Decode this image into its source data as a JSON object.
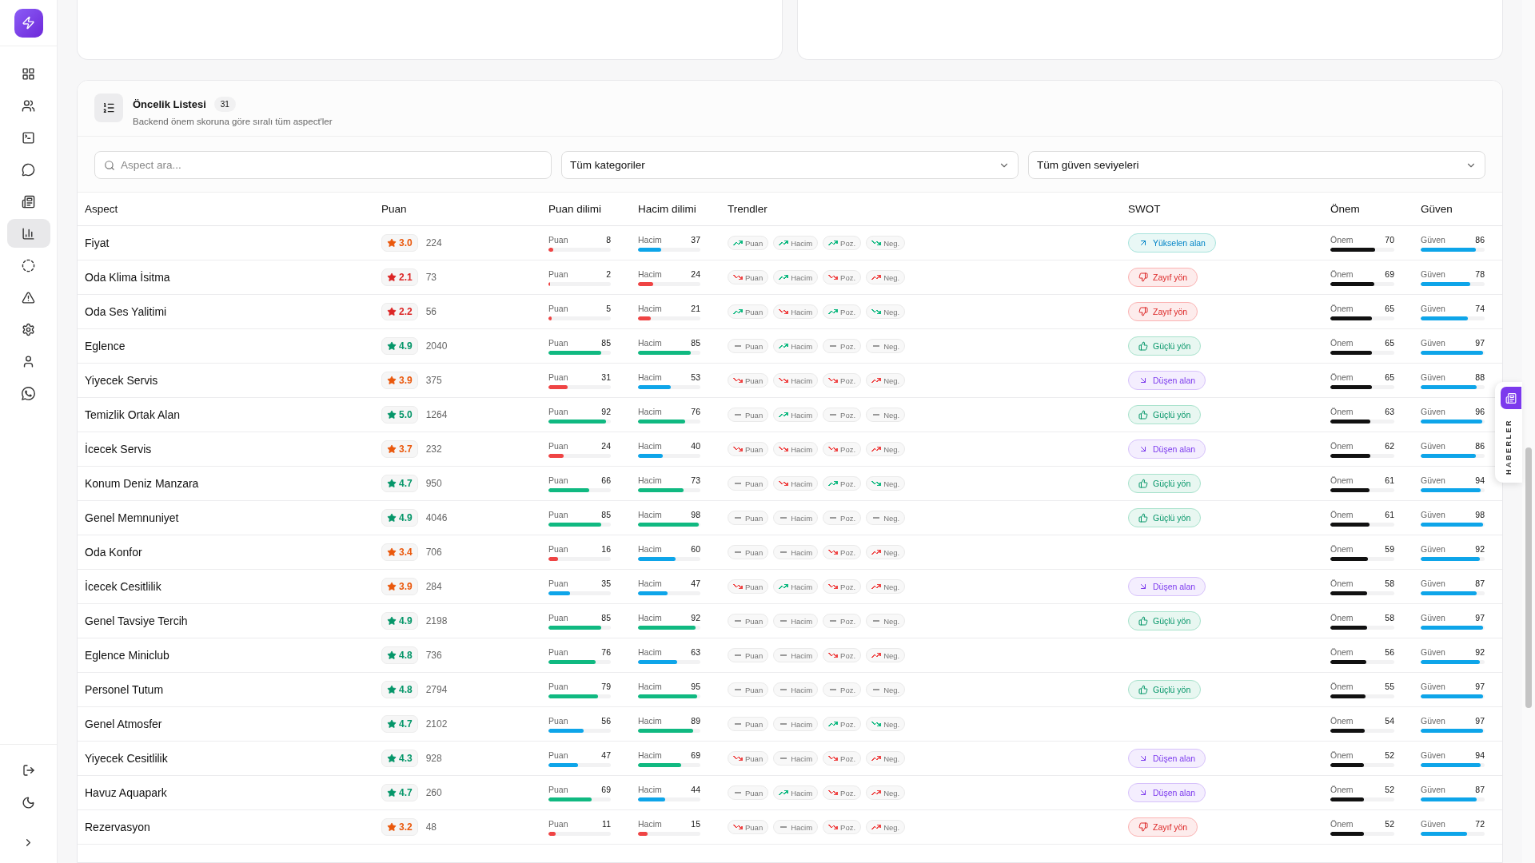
{
  "sidebar": {
    "items": [
      {
        "selected": false
      },
      {
        "selected": false
      },
      {
        "selected": false
      },
      {
        "selected": false
      },
      {
        "selected": false
      },
      {
        "selected": true
      },
      {
        "selected": false
      },
      {
        "selected": false
      },
      {
        "selected": false
      },
      {
        "selected": false
      },
      {
        "selected": false
      }
    ]
  },
  "priority_list": {
    "title": "Öncelik Listesi",
    "count": "31",
    "subtitle": "Backend önem skoruna göre sıralı tüm aspect'ler",
    "search": {
      "placeholder": "Aspect ara..."
    },
    "filters": [
      {
        "value": "Tüm kategoriler"
      },
      {
        "value": "Tüm güven seviyeleri"
      }
    ],
    "columns": [
      "Aspect",
      "Puan",
      "Puan dilimi",
      "Hacim dilimi",
      "Trendler",
      "SWOT",
      "Önem",
      "Güven"
    ],
    "rows": [
      {
        "aspect": "Fiyat",
        "rating": {
          "value": "3.0",
          "color": "#ea580c"
        },
        "reviews": "224",
        "score": {
          "label": "Puan",
          "value": "8",
          "level": 0.08
        },
        "volume": {
          "label": "Hacim",
          "value": "37",
          "level": 0.37
        },
        "trends": [
          {
            "label": "Puan",
            "kind": "up",
            "color": "#10b981"
          },
          {
            "label": "Hacim",
            "kind": "up",
            "color": "#10b981"
          },
          {
            "label": "Poz.",
            "kind": "up",
            "color": "#10b981"
          },
          {
            "label": "Neg.",
            "kind": "down",
            "color": "#10b981"
          }
        ],
        "swot": {
          "kind": "rising",
          "label": "Yükselen alan"
        },
        "importance": {
          "label": "Önem",
          "value": "70",
          "level": 0.7
        },
        "confidence": {
          "label": "Güven",
          "value": "86",
          "level": 0.86
        }
      },
      {
        "aspect": "Oda Klima İsitma",
        "rating": {
          "value": "2.1",
          "color": "#dc2626"
        },
        "reviews": "73",
        "score": {
          "label": "Puan",
          "value": "2",
          "level": 0.02
        },
        "volume": {
          "label": "Hacim",
          "value": "24",
          "level": 0.24
        },
        "trends": [
          {
            "label": "Puan",
            "kind": "down",
            "color": "#ef4444"
          },
          {
            "label": "Hacim",
            "kind": "up",
            "color": "#10b981"
          },
          {
            "label": "Poz.",
            "kind": "down",
            "color": "#ef4444"
          },
          {
            "label": "Neg.",
            "kind": "up",
            "color": "#ef4444"
          }
        ],
        "swot": {
          "kind": "weak",
          "label": "Zayıf yön"
        },
        "importance": {
          "label": "Önem",
          "value": "69",
          "level": 0.69
        },
        "confidence": {
          "label": "Güven",
          "value": "78",
          "level": 0.78
        }
      },
      {
        "aspect": "Oda Ses Yalitimi",
        "rating": {
          "value": "2.2",
          "color": "#dc2626"
        },
        "reviews": "56",
        "score": {
          "label": "Puan",
          "value": "5",
          "level": 0.05
        },
        "volume": {
          "label": "Hacim",
          "value": "21",
          "level": 0.21
        },
        "trends": [
          {
            "label": "Puan",
            "kind": "up",
            "color": "#10b981"
          },
          {
            "label": "Hacim",
            "kind": "down",
            "color": "#ef4444"
          },
          {
            "label": "Poz.",
            "kind": "up",
            "color": "#10b981"
          },
          {
            "label": "Neg.",
            "kind": "down",
            "color": "#10b981"
          }
        ],
        "swot": {
          "kind": "weak",
          "label": "Zayıf yön"
        },
        "importance": {
          "label": "Önem",
          "value": "65",
          "level": 0.65
        },
        "confidence": {
          "label": "Güven",
          "value": "74",
          "level": 0.74
        }
      },
      {
        "aspect": "Eglence",
        "rating": {
          "value": "4.9",
          "color": "#059669"
        },
        "reviews": "2040",
        "score": {
          "label": "Puan",
          "value": "85",
          "level": 0.85
        },
        "volume": {
          "label": "Hacim",
          "value": "85",
          "level": 0.85
        },
        "trends": [
          {
            "label": "Puan",
            "kind": "flat",
            "color": "#999999"
          },
          {
            "label": "Hacim",
            "kind": "up",
            "color": "#10b981"
          },
          {
            "label": "Poz.",
            "kind": "flat",
            "color": "#999999"
          },
          {
            "label": "Neg.",
            "kind": "flat",
            "color": "#999999"
          }
        ],
        "swot": {
          "kind": "strong",
          "label": "Güçlü yön"
        },
        "importance": {
          "label": "Önem",
          "value": "65",
          "level": 0.65
        },
        "confidence": {
          "label": "Güven",
          "value": "97",
          "level": 0.97
        }
      },
      {
        "aspect": "Yiyecek Servis",
        "rating": {
          "value": "3.9",
          "color": "#ea580c"
        },
        "reviews": "375",
        "score": {
          "label": "Puan",
          "value": "31",
          "level": 0.31
        },
        "volume": {
          "label": "Hacim",
          "value": "53",
          "level": 0.53
        },
        "trends": [
          {
            "label": "Puan",
            "kind": "down",
            "color": "#ef4444"
          },
          {
            "label": "Hacim",
            "kind": "down",
            "color": "#ef4444"
          },
          {
            "label": "Poz.",
            "kind": "down",
            "color": "#ef4444"
          },
          {
            "label": "Neg.",
            "kind": "up",
            "color": "#ef4444"
          }
        ],
        "swot": {
          "kind": "falling",
          "label": "Düşen alan"
        },
        "importance": {
          "label": "Önem",
          "value": "65",
          "level": 0.65
        },
        "confidence": {
          "label": "Güven",
          "value": "88",
          "level": 0.88
        }
      },
      {
        "aspect": "Temizlik Ortak Alan",
        "rating": {
          "value": "5.0",
          "color": "#059669"
        },
        "reviews": "1264",
        "score": {
          "label": "Puan",
          "value": "92",
          "level": 0.92
        },
        "volume": {
          "label": "Hacim",
          "value": "76",
          "level": 0.76
        },
        "trends": [
          {
            "label": "Puan",
            "kind": "flat",
            "color": "#999999"
          },
          {
            "label": "Hacim",
            "kind": "up",
            "color": "#10b981"
          },
          {
            "label": "Poz.",
            "kind": "flat",
            "color": "#999999"
          },
          {
            "label": "Neg.",
            "kind": "flat",
            "color": "#999999"
          }
        ],
        "swot": {
          "kind": "strong",
          "label": "Güçlü yön"
        },
        "importance": {
          "label": "Önem",
          "value": "63",
          "level": 0.63
        },
        "confidence": {
          "label": "Güven",
          "value": "96",
          "level": 0.96
        }
      },
      {
        "aspect": "İcecek Servis",
        "rating": {
          "value": "3.7",
          "color": "#ea580c"
        },
        "reviews": "232",
        "score": {
          "label": "Puan",
          "value": "24",
          "level": 0.24
        },
        "volume": {
          "label": "Hacim",
          "value": "40",
          "level": 0.4
        },
        "trends": [
          {
            "label": "Puan",
            "kind": "down",
            "color": "#ef4444"
          },
          {
            "label": "Hacim",
            "kind": "down",
            "color": "#ef4444"
          },
          {
            "label": "Poz.",
            "kind": "down",
            "color": "#ef4444"
          },
          {
            "label": "Neg.",
            "kind": "up",
            "color": "#ef4444"
          }
        ],
        "swot": {
          "kind": "falling",
          "label": "Düşen alan"
        },
        "importance": {
          "label": "Önem",
          "value": "62",
          "level": 0.62
        },
        "confidence": {
          "label": "Güven",
          "value": "86",
          "level": 0.86
        }
      },
      {
        "aspect": "Konum Deniz Manzara",
        "rating": {
          "value": "4.7",
          "color": "#059669"
        },
        "reviews": "950",
        "score": {
          "label": "Puan",
          "value": "66",
          "level": 0.66
        },
        "volume": {
          "label": "Hacim",
          "value": "73",
          "level": 0.73
        },
        "trends": [
          {
            "label": "Puan",
            "kind": "flat",
            "color": "#999999"
          },
          {
            "label": "Hacim",
            "kind": "down",
            "color": "#ef4444"
          },
          {
            "label": "Poz.",
            "kind": "up",
            "color": "#10b981"
          },
          {
            "label": "Neg.",
            "kind": "down",
            "color": "#10b981"
          }
        ],
        "swot": {
          "kind": "strong",
          "label": "Güçlü yön"
        },
        "importance": {
          "label": "Önem",
          "value": "61",
          "level": 0.61
        },
        "confidence": {
          "label": "Güven",
          "value": "94",
          "level": 0.94
        }
      },
      {
        "aspect": "Genel Memnuniyet",
        "rating": {
          "value": "4.9",
          "color": "#059669"
        },
        "reviews": "4046",
        "score": {
          "label": "Puan",
          "value": "85",
          "level": 0.85
        },
        "volume": {
          "label": "Hacim",
          "value": "98",
          "level": 0.98
        },
        "trends": [
          {
            "label": "Puan",
            "kind": "flat",
            "color": "#999999"
          },
          {
            "label": "Hacim",
            "kind": "flat",
            "color": "#999999"
          },
          {
            "label": "Poz.",
            "kind": "flat",
            "color": "#999999"
          },
          {
            "label": "Neg.",
            "kind": "flat",
            "color": "#999999"
          }
        ],
        "swot": {
          "kind": "strong",
          "label": "Güçlü yön"
        },
        "importance": {
          "label": "Önem",
          "value": "61",
          "level": 0.61
        },
        "confidence": {
          "label": "Güven",
          "value": "98",
          "level": 0.98
        }
      },
      {
        "aspect": "Oda Konfor",
        "rating": {
          "value": "3.4",
          "color": "#ea580c"
        },
        "reviews": "706",
        "score": {
          "label": "Puan",
          "value": "16",
          "level": 0.16
        },
        "volume": {
          "label": "Hacim",
          "value": "60",
          "level": 0.6
        },
        "trends": [
          {
            "label": "Puan",
            "kind": "flat",
            "color": "#999999"
          },
          {
            "label": "Hacim",
            "kind": "flat",
            "color": "#999999"
          },
          {
            "label": "Poz.",
            "kind": "down",
            "color": "#ef4444"
          },
          {
            "label": "Neg.",
            "kind": "up",
            "color": "#ef4444"
          }
        ],
        "importance": {
          "label": "Önem",
          "value": "59",
          "level": 0.59
        },
        "confidence": {
          "label": "Güven",
          "value": "92",
          "level": 0.92
        }
      },
      {
        "aspect": "İcecek Cesitlilik",
        "rating": {
          "value": "3.9",
          "color": "#ea580c"
        },
        "reviews": "284",
        "score": {
          "label": "Puan",
          "value": "35",
          "level": 0.35
        },
        "volume": {
          "label": "Hacim",
          "value": "47",
          "level": 0.47
        },
        "trends": [
          {
            "label": "Puan",
            "kind": "down",
            "color": "#ef4444"
          },
          {
            "label": "Hacim",
            "kind": "up",
            "color": "#10b981"
          },
          {
            "label": "Poz.",
            "kind": "down",
            "color": "#ef4444"
          },
          {
            "label": "Neg.",
            "kind": "up",
            "color": "#ef4444"
          }
        ],
        "swot": {
          "kind": "falling",
          "label": "Düşen alan"
        },
        "importance": {
          "label": "Önem",
          "value": "58",
          "level": 0.58
        },
        "confidence": {
          "label": "Güven",
          "value": "87",
          "level": 0.87
        }
      },
      {
        "aspect": "Genel Tavsiye Tercih",
        "rating": {
          "value": "4.9",
          "color": "#059669"
        },
        "reviews": "2198",
        "score": {
          "label": "Puan",
          "value": "85",
          "level": 0.85
        },
        "volume": {
          "label": "Hacim",
          "value": "92",
          "level": 0.92
        },
        "trends": [
          {
            "label": "Puan",
            "kind": "flat",
            "color": "#999999"
          },
          {
            "label": "Hacim",
            "kind": "flat",
            "color": "#999999"
          },
          {
            "label": "Poz.",
            "kind": "flat",
            "color": "#999999"
          },
          {
            "label": "Neg.",
            "kind": "flat",
            "color": "#999999"
          }
        ],
        "swot": {
          "kind": "strong",
          "label": "Güçlü yön"
        },
        "importance": {
          "label": "Önem",
          "value": "58",
          "level": 0.58
        },
        "confidence": {
          "label": "Güven",
          "value": "97",
          "level": 0.97
        }
      },
      {
        "aspect": "Eglence Miniclub",
        "rating": {
          "value": "4.8",
          "color": "#059669"
        },
        "reviews": "736",
        "score": {
          "label": "Puan",
          "value": "76",
          "level": 0.76
        },
        "volume": {
          "label": "Hacim",
          "value": "63",
          "level": 0.63
        },
        "trends": [
          {
            "label": "Puan",
            "kind": "flat",
            "color": "#999999"
          },
          {
            "label": "Hacim",
            "kind": "flat",
            "color": "#999999"
          },
          {
            "label": "Poz.",
            "kind": "down",
            "color": "#ef4444"
          },
          {
            "label": "Neg.",
            "kind": "up",
            "color": "#ef4444"
          }
        ],
        "importance": {
          "label": "Önem",
          "value": "56",
          "level": 0.56
        },
        "confidence": {
          "label": "Güven",
          "value": "92",
          "level": 0.92
        }
      },
      {
        "aspect": "Personel Tutum",
        "rating": {
          "value": "4.8",
          "color": "#059669"
        },
        "reviews": "2794",
        "score": {
          "label": "Puan",
          "value": "79",
          "level": 0.79
        },
        "volume": {
          "label": "Hacim",
          "value": "95",
          "level": 0.95
        },
        "trends": [
          {
            "label": "Puan",
            "kind": "flat",
            "color": "#999999"
          },
          {
            "label": "Hacim",
            "kind": "flat",
            "color": "#999999"
          },
          {
            "label": "Poz.",
            "kind": "flat",
            "color": "#999999"
          },
          {
            "label": "Neg.",
            "kind": "flat",
            "color": "#999999"
          }
        ],
        "swot": {
          "kind": "strong",
          "label": "Güçlü yön"
        },
        "importance": {
          "label": "Önem",
          "value": "55",
          "level": 0.55
        },
        "confidence": {
          "label": "Güven",
          "value": "97",
          "level": 0.97
        }
      },
      {
        "aspect": "Genel Atmosfer",
        "rating": {
          "value": "4.7",
          "color": "#059669"
        },
        "reviews": "2102",
        "score": {
          "label": "Puan",
          "value": "56",
          "level": 0.56
        },
        "volume": {
          "label": "Hacim",
          "value": "89",
          "level": 0.89
        },
        "trends": [
          {
            "label": "Puan",
            "kind": "flat",
            "color": "#999999"
          },
          {
            "label": "Hacim",
            "kind": "flat",
            "color": "#999999"
          },
          {
            "label": "Poz.",
            "kind": "up",
            "color": "#10b981"
          },
          {
            "label": "Neg.",
            "kind": "down",
            "color": "#10b981"
          }
        ],
        "importance": {
          "label": "Önem",
          "value": "54",
          "level": 0.54
        },
        "confidence": {
          "label": "Güven",
          "value": "97",
          "level": 0.97
        }
      },
      {
        "aspect": "Yiyecek Cesitlilik",
        "rating": {
          "value": "4.3",
          "color": "#059669"
        },
        "reviews": "928",
        "score": {
          "label": "Puan",
          "value": "47",
          "level": 0.47
        },
        "volume": {
          "label": "Hacim",
          "value": "69",
          "level": 0.69
        },
        "trends": [
          {
            "label": "Puan",
            "kind": "down",
            "color": "#ef4444"
          },
          {
            "label": "Hacim",
            "kind": "flat",
            "color": "#999999"
          },
          {
            "label": "Poz.",
            "kind": "down",
            "color": "#ef4444"
          },
          {
            "label": "Neg.",
            "kind": "up",
            "color": "#ef4444"
          }
        ],
        "swot": {
          "kind": "falling",
          "label": "Düşen alan"
        },
        "importance": {
          "label": "Önem",
          "value": "52",
          "level": 0.52
        },
        "confidence": {
          "label": "Güven",
          "value": "94",
          "level": 0.94
        }
      },
      {
        "aspect": "Havuz Aquapark",
        "rating": {
          "value": "4.7",
          "color": "#059669"
        },
        "reviews": "260",
        "score": {
          "label": "Puan",
          "value": "69",
          "level": 0.69
        },
        "volume": {
          "label": "Hacim",
          "value": "44",
          "level": 0.44
        },
        "trends": [
          {
            "label": "Puan",
            "kind": "flat",
            "color": "#999999"
          },
          {
            "label": "Hacim",
            "kind": "up",
            "color": "#10b981"
          },
          {
            "label": "Poz.",
            "kind": "down",
            "color": "#ef4444"
          },
          {
            "label": "Neg.",
            "kind": "up",
            "color": "#ef4444"
          }
        ],
        "swot": {
          "kind": "falling",
          "label": "Düşen alan"
        },
        "importance": {
          "label": "Önem",
          "value": "52",
          "level": 0.52
        },
        "confidence": {
          "label": "Güven",
          "value": "87",
          "level": 0.87
        }
      },
      {
        "aspect": "Rezervasyon",
        "rating": {
          "value": "3.2",
          "color": "#ea580c"
        },
        "reviews": "48",
        "score": {
          "label": "Puan",
          "value": "11",
          "level": 0.11
        },
        "volume": {
          "label": "Hacim",
          "value": "15",
          "level": 0.15
        },
        "trends": [
          {
            "label": "Puan",
            "kind": "down",
            "color": "#ef4444"
          },
          {
            "label": "Hacim",
            "kind": "flat",
            "color": "#999999"
          },
          {
            "label": "Poz.",
            "kind": "down",
            "color": "#ef4444"
          },
          {
            "label": "Neg.",
            "kind": "up",
            "color": "#ef4444"
          }
        ],
        "swot": {
          "kind": "weak",
          "label": "Zayıf yön"
        },
        "importance": {
          "label": "Önem",
          "value": "52",
          "level": 0.52
        },
        "confidence": {
          "label": "Güven",
          "value": "72",
          "level": 0.72
        }
      }
    ]
  },
  "news_tab": {
    "label": "HABERLER"
  }
}
